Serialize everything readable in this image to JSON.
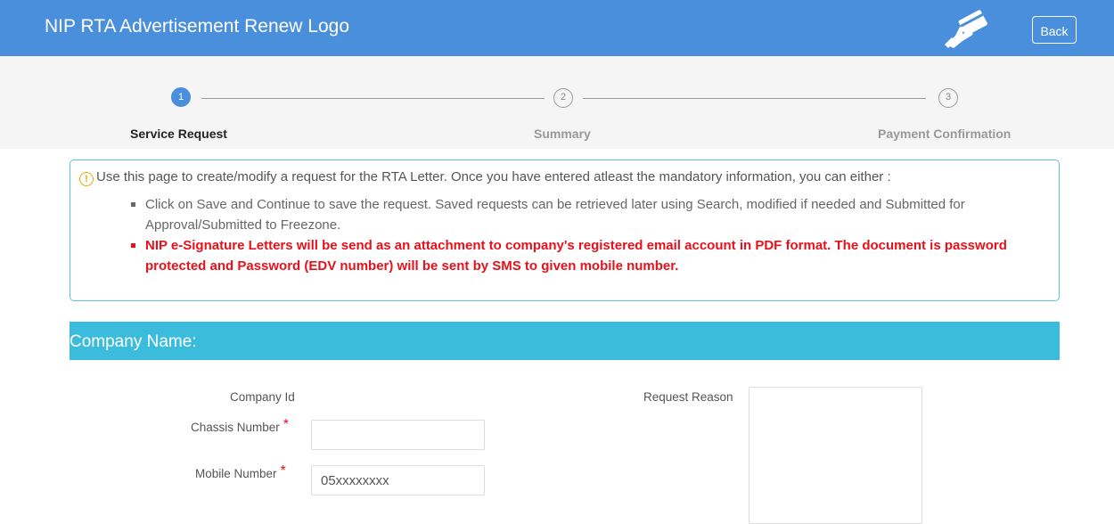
{
  "header": {
    "title": "NIP RTA Advertisement Renew Logo",
    "logo_icon": "hand-card-icon",
    "back_label": "Back",
    "color": "#4a8fdc"
  },
  "wizard": {
    "steps": [
      {
        "number": "1",
        "label": "Service Request",
        "active": true
      },
      {
        "number": "2",
        "label": "Summary",
        "active": false
      },
      {
        "number": "3",
        "label": "Payment Confirmation",
        "active": false
      }
    ]
  },
  "info": {
    "icon": "info-icon",
    "intro": "Use this page to create/modify a request for the RTA Letter. Once you have entered atleast the mandatory information, you can either :",
    "bullets": [
      "Click on Save and Continue to save the request. Saved requests can be retrieved later using Search, modified if needed and Submitted for Approval/Submitted to Freezone.",
      "NIP e-Signature Letters will be send as an attachment to company's registered email account in PDF format. The document is password protected and Password (EDV number) will be sent by SMS to given mobile number."
    ]
  },
  "section": {
    "title": "Company Name:",
    "color": "#3bbcdd"
  },
  "form": {
    "company_id_label": "Company Id",
    "chassis_label": "Chassis Number",
    "chassis_value": "",
    "mobile_label": "Mobile Number",
    "mobile_value": "05xxxxxxxx",
    "required_mark": "*",
    "request_reason_label": "Request Reason",
    "request_reason_value": ""
  }
}
